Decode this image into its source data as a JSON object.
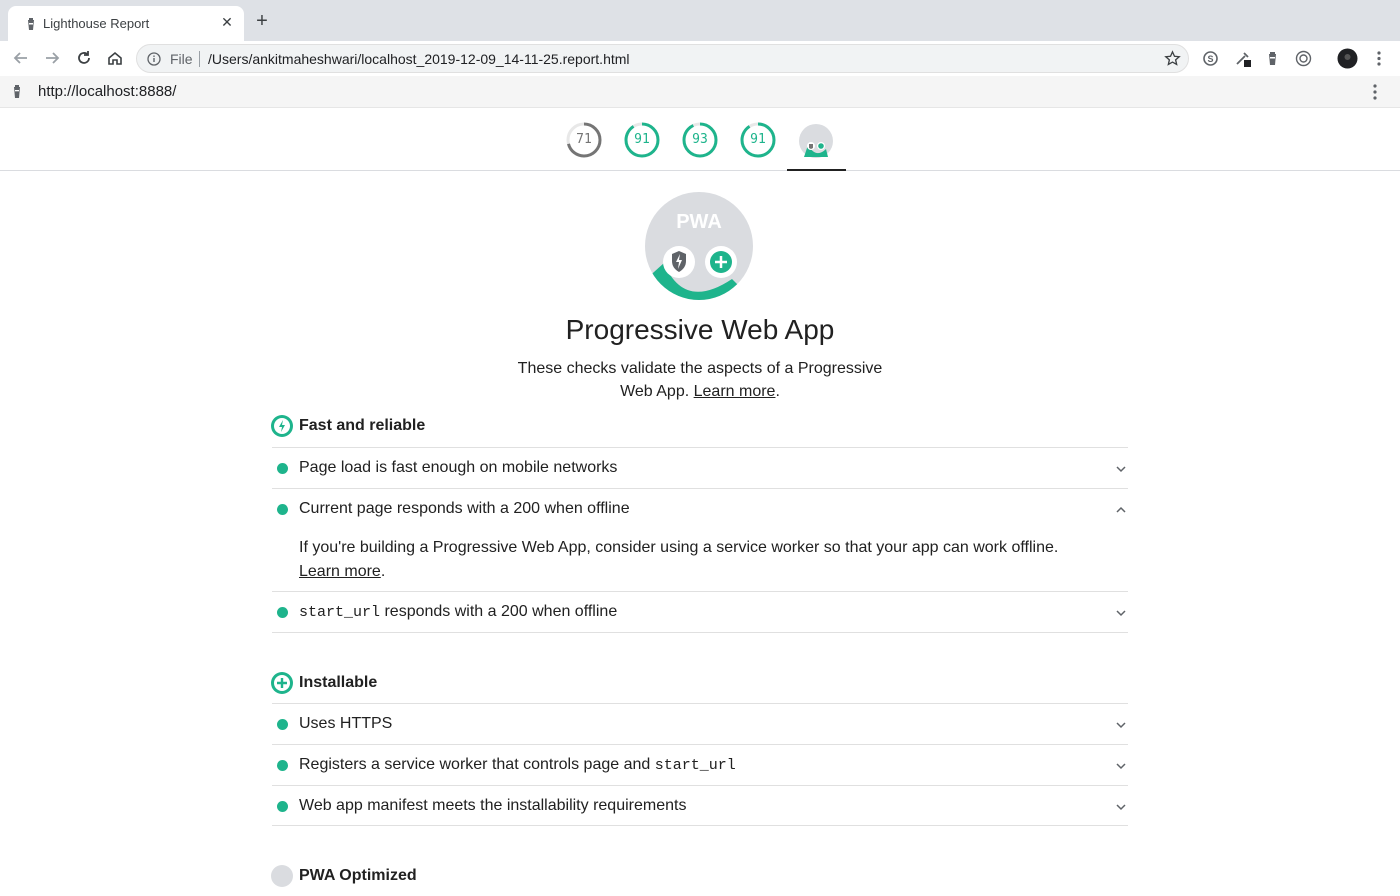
{
  "browser": {
    "tab_title": "Lighthouse Report",
    "omnibox_scheme": "File",
    "omnibox_url": "/Users/ankitmaheshwari/localhost_2019-12-09_14-11-25.report.html",
    "page_url": "http://localhost:8888/"
  },
  "scores": [
    {
      "label": "71",
      "value": 71,
      "color": "#757575"
    },
    {
      "label": "91",
      "value": 91,
      "color": "#1eb48c"
    },
    {
      "label": "93",
      "value": 93,
      "color": "#1eb48c"
    },
    {
      "label": "91",
      "value": 91,
      "color": "#1eb48c"
    }
  ],
  "category": {
    "badge_text": "PWA",
    "title": "Progressive Web App",
    "desc_text": "These checks validate the aspects of a Progressive Web App.",
    "desc_link": "Learn more",
    "desc_end": "."
  },
  "groups": {
    "fast": {
      "title": "Fast and reliable",
      "audits": [
        {
          "title": "Page load is fast enough on mobile networks",
          "expanded": false
        },
        {
          "title": "Current page responds with a 200 when offline",
          "expanded": true,
          "detail_text": "If you're building a Progressive Web App, consider using a service worker so that your app can work offline.",
          "detail_link": "Learn more",
          "detail_end": "."
        },
        {
          "title_code": "start_url",
          "title_rest": " responds with a 200 when offline",
          "expanded": false
        }
      ]
    },
    "installable": {
      "title": "Installable",
      "audits": [
        {
          "title": "Uses HTTPS"
        },
        {
          "title_text": "Registers a service worker that controls page and ",
          "title_code": "start_url"
        },
        {
          "title": "Web app manifest meets the installability requirements"
        }
      ]
    },
    "optimized": {
      "title": "PWA Optimized"
    }
  },
  "colors": {
    "pass": "#18b663",
    "pwa_teal": "#1eb48c",
    "accent_gray": "#757575"
  }
}
